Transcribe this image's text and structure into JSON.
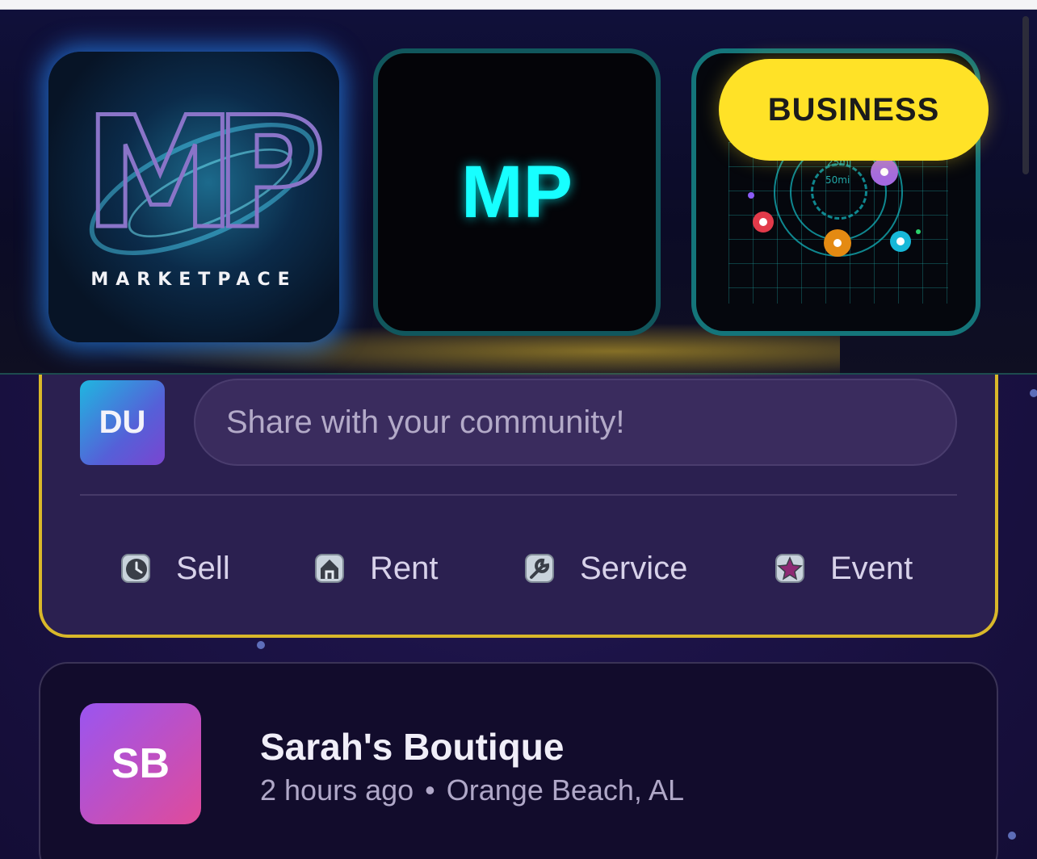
{
  "header": {
    "logo": {
      "monogram": "MP",
      "wordmark": "MARKETPACE"
    },
    "mp_tile": {
      "label": "MP"
    },
    "business_tile": {
      "badge": "BUSINESS",
      "radius_labels": [
        "25mi",
        "50mi"
      ]
    }
  },
  "composer": {
    "avatar_initials": "DU",
    "input_placeholder": "Share with your community!",
    "actions": [
      {
        "label": "Sell",
        "icon": "clock-icon"
      },
      {
        "label": "Rent",
        "icon": "house-icon"
      },
      {
        "label": "Service",
        "icon": "wrench-icon"
      },
      {
        "label": "Event",
        "icon": "star-icon"
      }
    ]
  },
  "post": {
    "avatar_initials": "SB",
    "author": "Sarah's Boutique",
    "time": "2 hours ago",
    "separator": "•",
    "location": "Orange Beach, AL"
  },
  "colors": {
    "accent_yellow": "#ffe227",
    "accent_cyan": "#17ffff",
    "card_border": "#d9b82a"
  }
}
